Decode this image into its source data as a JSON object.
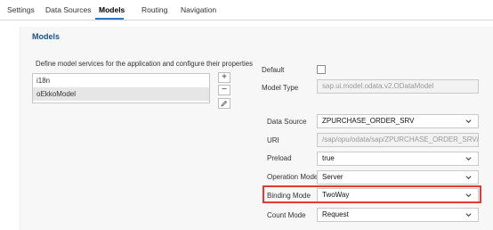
{
  "tabs": [
    {
      "label": "Settings"
    },
    {
      "label": "Data Sources"
    },
    {
      "label": "Models"
    },
    {
      "label": "Routing"
    },
    {
      "label": "Navigation"
    }
  ],
  "section": {
    "title": "Models"
  },
  "models": {
    "description": "Define model services for the application and configure their properties",
    "items": [
      {
        "label": "i18n"
      },
      {
        "label": "oEkkoModel"
      }
    ],
    "add_label": "+",
    "remove_label": "−",
    "edit_icon": "pencil-icon"
  },
  "properties": {
    "default": {
      "label": "Default",
      "checked": false
    },
    "model_type": {
      "label": "Model Type",
      "value": "sap.ui.model.odata.v2.ODataModel"
    },
    "data_source": {
      "label": "Data Source",
      "value": "ZPURCHASE_ORDER_SRV"
    },
    "uri": {
      "label": "URI",
      "value": "/sap/opu/odata/sap/ZPURCHASE_ORDER_SRV/"
    },
    "preload": {
      "label": "Preload",
      "value": "true"
    },
    "operation_mode": {
      "label": "Operation Mode",
      "value": "Server"
    },
    "binding_mode": {
      "label": "Binding Mode",
      "value": "TwoWay"
    },
    "count_mode": {
      "label": "Count Mode",
      "value": "Request"
    }
  },
  "colors": {
    "accent": "#2f77c7",
    "highlight": "#e53935",
    "title": "#1a4f88"
  }
}
